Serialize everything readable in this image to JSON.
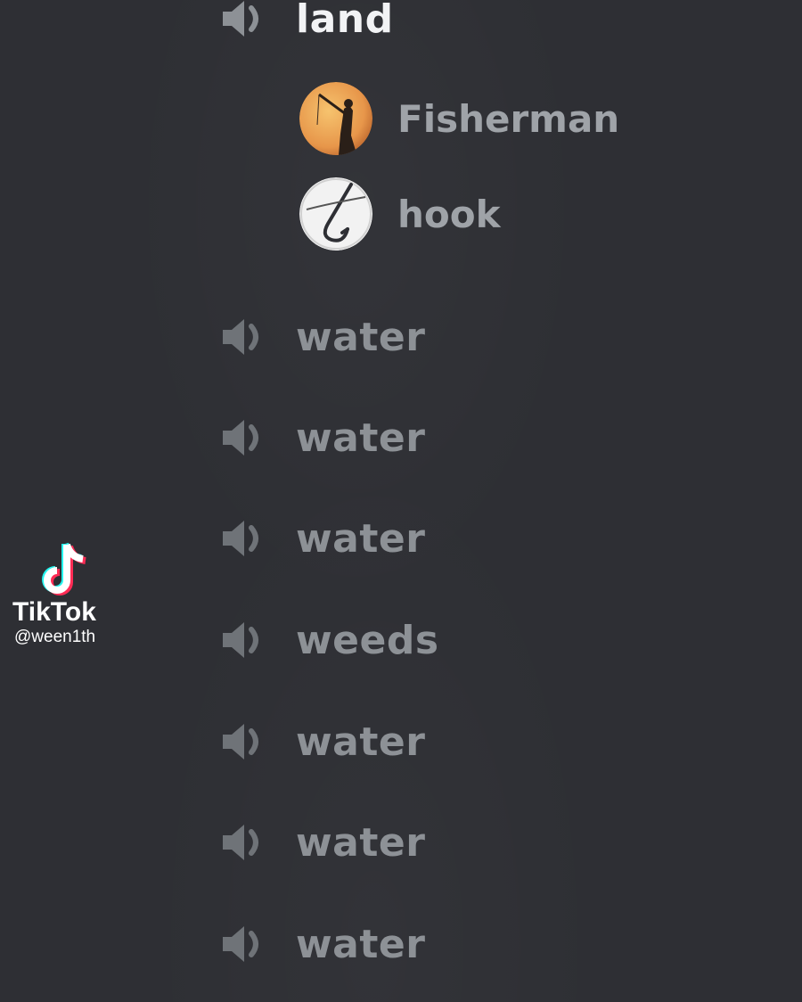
{
  "colors": {
    "background": "#2e2f34",
    "channel_text": "#8d9196",
    "channel_text_active": "#f2f3f5",
    "user_text": "#9fa3a8"
  },
  "channels_top": {
    "active": {
      "label": "land",
      "icon": "speaker-icon"
    },
    "users": [
      {
        "name": "Fisherman",
        "avatar": "fisherman-avatar"
      },
      {
        "name": "hook",
        "avatar": "hook-avatar"
      }
    ]
  },
  "channels": [
    {
      "label": "water",
      "icon": "speaker-icon"
    },
    {
      "label": "water",
      "icon": "speaker-icon"
    },
    {
      "label": "water",
      "icon": "speaker-icon"
    },
    {
      "label": "weeds",
      "icon": "speaker-icon"
    },
    {
      "label": "water",
      "icon": "speaker-icon"
    },
    {
      "label": "water",
      "icon": "speaker-icon"
    },
    {
      "label": "water",
      "icon": "speaker-icon"
    }
  ],
  "watermark": {
    "brand": "TikTok",
    "handle": "@ween1th",
    "icon": "tiktok-note-icon"
  }
}
